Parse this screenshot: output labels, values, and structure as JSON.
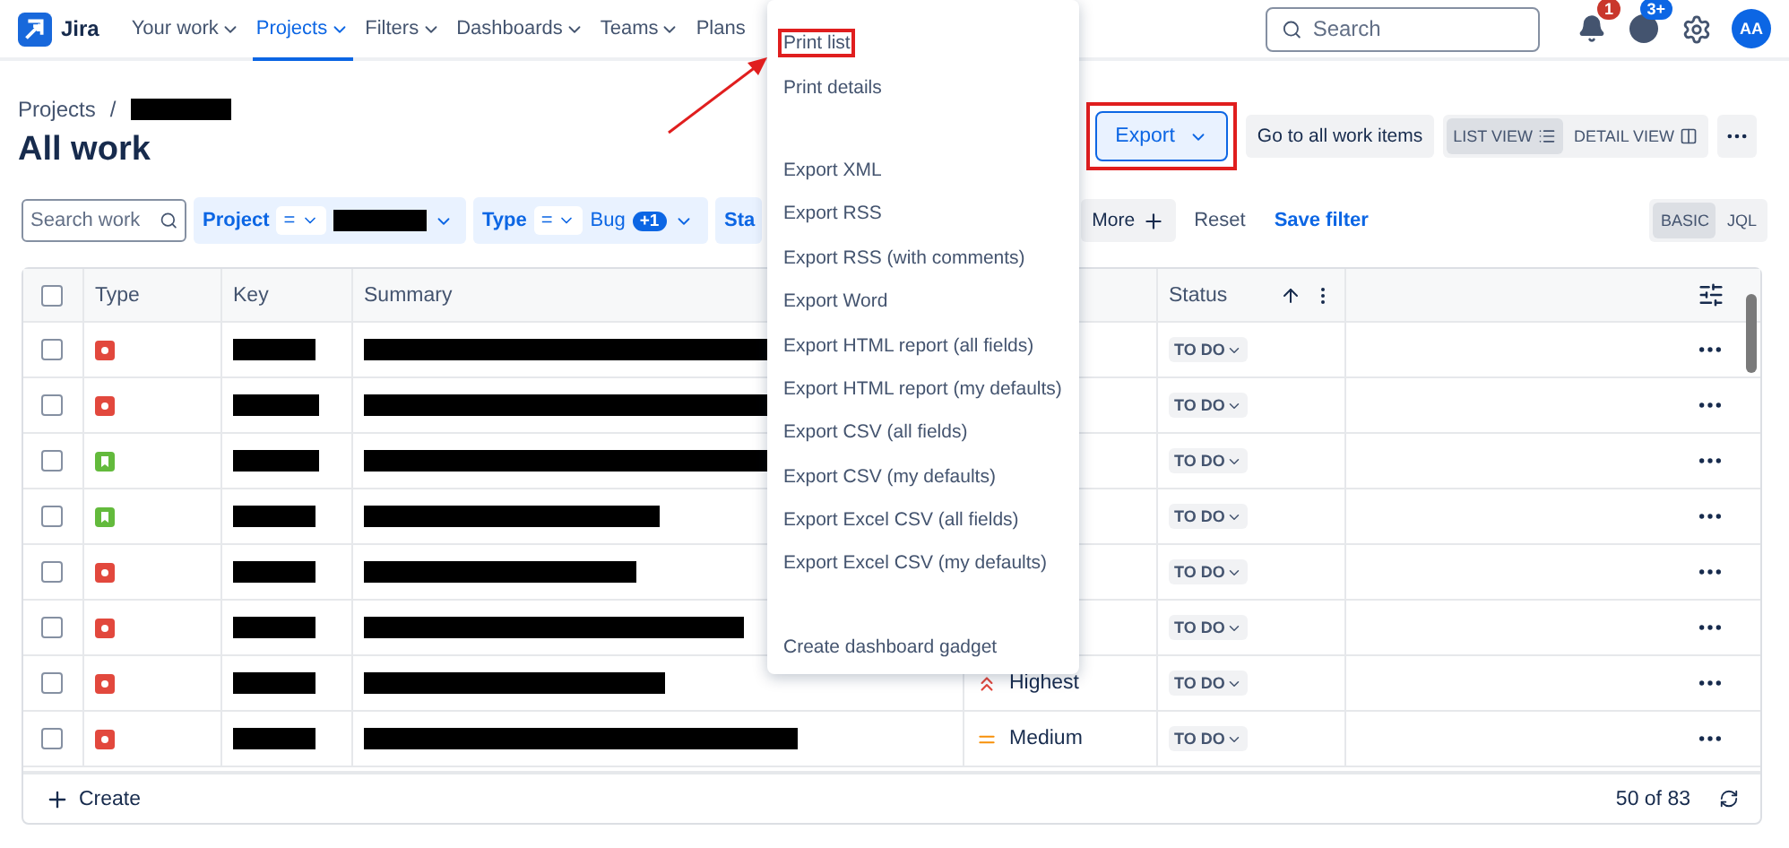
{
  "nav": {
    "logo": "Jira",
    "items": [
      {
        "label": "Your work",
        "selected": false
      },
      {
        "label": "Projects",
        "selected": true
      },
      {
        "label": "Filters",
        "selected": false
      },
      {
        "label": "Dashboards",
        "selected": false
      },
      {
        "label": "Teams",
        "selected": false
      },
      {
        "label": "Plans",
        "selected": false
      }
    ],
    "search": {
      "placeholder": "Search"
    },
    "notifications_badge": "1",
    "help_badge": "3+",
    "avatar": "AA"
  },
  "breadcrumb": "Projects",
  "breadcrumb_separator": "/",
  "title": "All work",
  "actions": {
    "export": {
      "label": "Export",
      "highlighted": true
    },
    "go_to_all": "Go to all work items",
    "views": [
      {
        "label": "LIST VIEW",
        "selected": true
      },
      {
        "label": "DETAIL VIEW",
        "selected": false
      }
    ]
  },
  "filters": {
    "search": {
      "placeholder": "Search work"
    },
    "project": {
      "label": "Project",
      "operator": "="
    },
    "type": {
      "label": "Type",
      "operator": "=",
      "value": "Bug",
      "extra": "+1"
    },
    "status_partial": "Sta",
    "more": "More",
    "reset": "Reset",
    "save": "Save filter",
    "modes": [
      {
        "label": "BASIC",
        "selected": true
      },
      {
        "label": "JQL",
        "selected": false
      }
    ]
  },
  "table": {
    "columns": [
      "Type",
      "Key",
      "Summary",
      "Status"
    ],
    "all_checked": false,
    "rows": [
      {
        "kind": "bug",
        "checked": false,
        "priority": null,
        "status": "TO DO"
      },
      {
        "kind": "bug",
        "checked": false,
        "priority": null,
        "status": "TO DO"
      },
      {
        "kind": "story",
        "checked": false,
        "priority": null,
        "status": "TO DO"
      },
      {
        "kind": "story",
        "checked": false,
        "priority": null,
        "status": "TO DO"
      },
      {
        "kind": "bug",
        "checked": false,
        "priority": null,
        "status": "TO DO"
      },
      {
        "kind": "bug",
        "checked": false,
        "priority": null,
        "status": "TO DO"
      },
      {
        "kind": "bug",
        "checked": false,
        "priority": {
          "kind": "highest",
          "label": "Highest"
        },
        "status": "TO DO"
      },
      {
        "kind": "bug",
        "checked": false,
        "priority": {
          "kind": "medium",
          "label": "Medium"
        },
        "status": "TO DO"
      }
    ],
    "create": "Create",
    "count": "50 of 83"
  },
  "export_menu": {
    "sections": [
      [
        {
          "label": "Print list",
          "highlighted": true
        },
        {
          "label": "Print details",
          "highlighted": false
        }
      ],
      [
        {
          "label": "Export XML",
          "highlighted": false
        },
        {
          "label": "Export RSS",
          "highlighted": false
        },
        {
          "label": "Export RSS (with comments)",
          "highlighted": false
        },
        {
          "label": "Export Word",
          "highlighted": false
        },
        {
          "label": "Export HTML report (all fields)",
          "highlighted": false
        },
        {
          "label": "Export HTML report (my defaults)",
          "highlighted": false
        },
        {
          "label": "Export CSV (all fields)",
          "highlighted": false
        },
        {
          "label": "Export CSV (my defaults)",
          "highlighted": false
        },
        {
          "label": "Export Excel CSV (all fields)",
          "highlighted": false
        },
        {
          "label": "Export Excel CSV (my defaults)",
          "highlighted": false
        }
      ],
      [
        {
          "label": "Create dashboard gadget",
          "highlighted": false
        }
      ]
    ]
  }
}
